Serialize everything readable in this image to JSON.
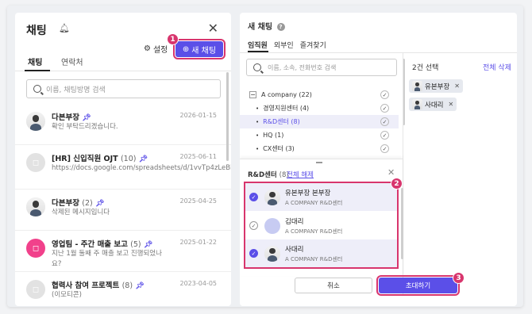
{
  "left": {
    "title": "채팅",
    "tabs": [
      "채팅",
      "연락처"
    ],
    "settings_label": "설정",
    "new_chat_label": "새 채팅",
    "search_placeholder": "이름, 채팅방명 검색",
    "chats": [
      {
        "title": "다븐부장",
        "count": "",
        "sub": "확인 부탁드리겠습니다.",
        "date": "2026-01-15",
        "avatar": "person"
      },
      {
        "title": "[HR] 신입직원 OJT",
        "count": "(10)",
        "sub": "https://docs.google.com/spreadsheets/d/1vvTp4zLeBb...",
        "date": "2025-06-11",
        "avatar": "group"
      },
      {
        "title": "다븐부장",
        "count": "(2)",
        "sub": "삭제된 메시지입니다",
        "date": "2025-04-25",
        "avatar": "person"
      },
      {
        "title": "영업팀 - 주간 매출 보고",
        "count": "(5)",
        "sub": "지난 1월 둘째 주 매출 보고 진행되었나요?",
        "date": "2025-01-22",
        "avatar": "pink"
      },
      {
        "title": "협력사 참여 프로젝트",
        "count": "(8)",
        "sub": "(이모티콘)",
        "date": "2023-04-05",
        "avatar": "group"
      }
    ]
  },
  "right": {
    "title": "새 채팅",
    "tabs": [
      "임직원",
      "외부인",
      "즐겨찾기"
    ],
    "search_placeholder": "이름, 소속, 전화번호 검색",
    "tree": [
      {
        "label": "A company (22)"
      },
      {
        "label": "경영지원센터 (4)"
      },
      {
        "label": "R&D센터 (8)"
      },
      {
        "label": "HQ (1)"
      },
      {
        "label": "CX센터 (3)"
      }
    ],
    "selected_count_label": "2건 선택",
    "clear_all_label": "전체 삭제",
    "selected": [
      "유본부장",
      "사대리"
    ],
    "dept": {
      "title": "R&D센터",
      "count": "(8)",
      "clear_label": "전체 해제",
      "members": [
        {
          "name": "유본부장 본부장",
          "org": "A COMPANY  R&D센터",
          "selected": true
        },
        {
          "name": "김대리",
          "org": "A COMPANY  R&D센터",
          "selected": false
        },
        {
          "name": "사대리",
          "org": "A COMPANY  R&D센터",
          "selected": true
        }
      ]
    },
    "cancel_label": "취소",
    "invite_label": "초대하기"
  },
  "markers": [
    "1",
    "2",
    "3"
  ],
  "colors": {
    "accent": "#5b4fe8",
    "highlight": "#d8356d",
    "pin": "#5b4fe8"
  }
}
